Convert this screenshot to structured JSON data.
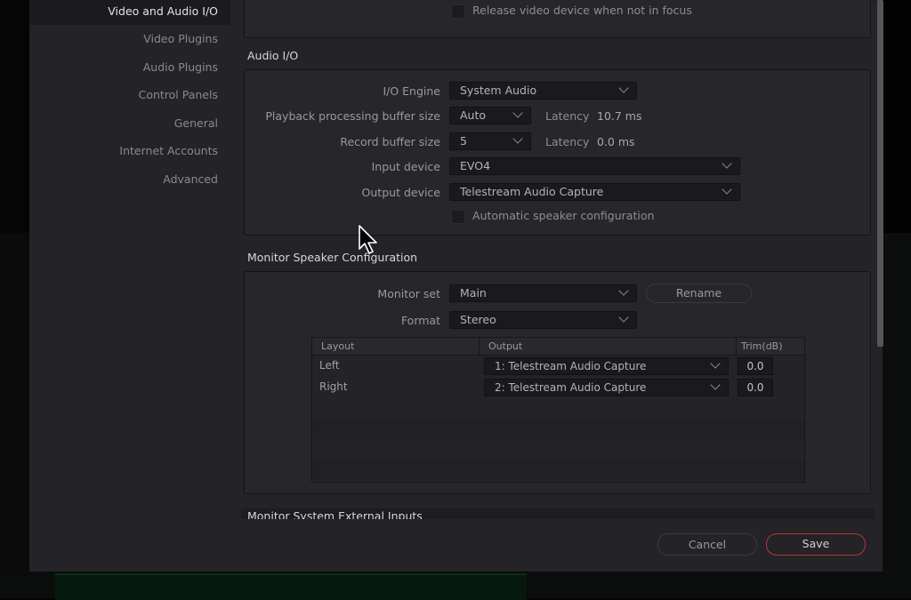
{
  "sidebar": {
    "items": [
      {
        "label": "Video and Audio I/O",
        "active": true
      },
      {
        "label": "Video Plugins",
        "active": false
      },
      {
        "label": "Audio Plugins",
        "active": false
      },
      {
        "label": "Control Panels",
        "active": false
      },
      {
        "label": "General",
        "active": false
      },
      {
        "label": "Internet Accounts",
        "active": false
      },
      {
        "label": "Advanced",
        "active": false
      }
    ]
  },
  "video_io": {
    "release_device_label": "Release video device when not in focus",
    "release_device_checked": false
  },
  "audio_io": {
    "title": "Audio I/O",
    "io_engine_label": "I/O Engine",
    "io_engine_value": "System Audio",
    "playback_buffer_label": "Playback processing buffer size",
    "playback_buffer_value": "Auto",
    "playback_latency_label": "Latency",
    "playback_latency_value": "10.7 ms",
    "record_buffer_label": "Record buffer size",
    "record_buffer_value": "5",
    "record_latency_label": "Latency",
    "record_latency_value": "0.0 ms",
    "input_device_label": "Input device",
    "input_device_value": "EVO4",
    "output_device_label": "Output device",
    "output_device_value": "Telestream Audio Capture",
    "auto_speaker_label": "Automatic speaker configuration",
    "auto_speaker_checked": false
  },
  "monitor_speaker": {
    "title": "Monitor Speaker Configuration",
    "monitor_set_label": "Monitor set",
    "monitor_set_value": "Main",
    "rename_label": "Rename",
    "format_label": "Format",
    "format_value": "Stereo",
    "table": {
      "headers": [
        "Layout",
        "Output",
        "Trim(dB)"
      ],
      "rows": [
        {
          "layout": "Left",
          "output": "1: Telestream Audio Capture",
          "trim": "0.0"
        },
        {
          "layout": "Right",
          "output": "2: Telestream Audio Capture",
          "trim": "0.0"
        }
      ]
    }
  },
  "external_inputs": {
    "title": "Monitor System External Inputs"
  },
  "footer": {
    "cancel_label": "Cancel",
    "save_label": "Save"
  },
  "colors": {
    "save_border": "#b23a2e",
    "dialog_bg": "#232328"
  }
}
